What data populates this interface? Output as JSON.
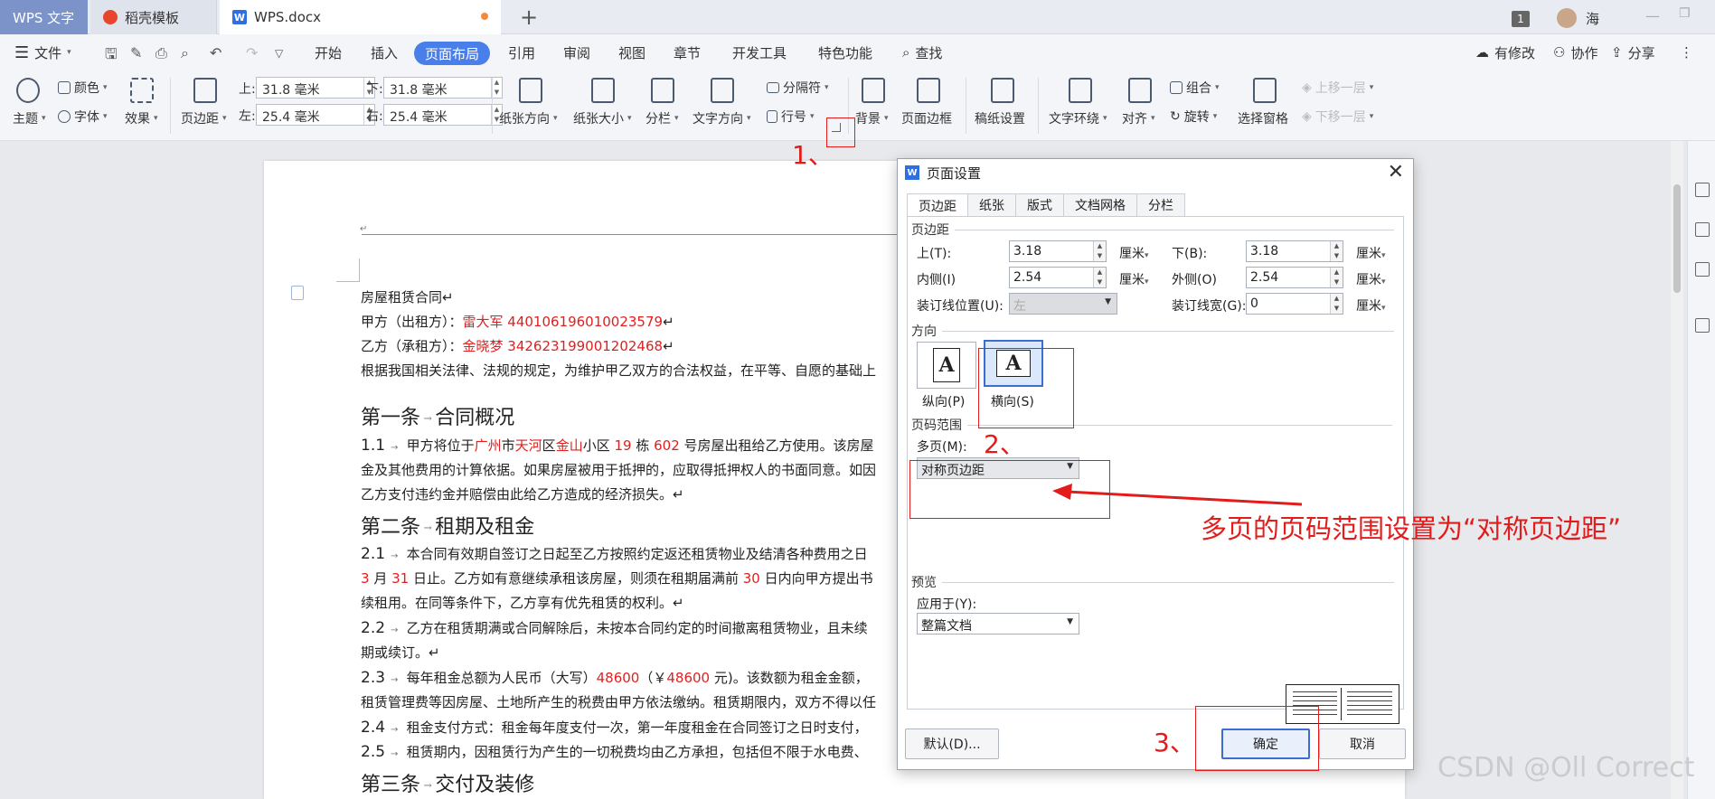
{
  "tabs": {
    "app": "WPS 文字",
    "template": "稻壳模板",
    "document": "WPS.docx",
    "new_tab_symbol": "+",
    "badge": "1",
    "user": "海"
  },
  "menu": {
    "file": "文件",
    "items": [
      "开始",
      "插入",
      "页面布局",
      "引用",
      "审阅",
      "视图",
      "章节",
      "开发工具",
      "特色功能"
    ],
    "active": "页面布局",
    "search": "查找",
    "right": [
      "有修改",
      "协作",
      "分享"
    ]
  },
  "ribbon": {
    "theme": "主题",
    "color": "颜色",
    "font": "字体",
    "effect": "效果",
    "margin": "页边距",
    "top_label": "上:",
    "top_value": "31.8 毫米",
    "bottom_label": "下:",
    "bottom_value": "31.8 毫米",
    "left_label": "左:",
    "left_value": "25.4 毫米",
    "right_label": "右:",
    "right_value": "25.4 毫米",
    "orientation": "纸张方向",
    "size": "纸张大小",
    "columns": "分栏",
    "text_direction": "文字方向",
    "separator": "分隔符",
    "line_number": "行号",
    "background": "背景",
    "page_border": "页面边框",
    "manuscript": "稿纸设置",
    "wrap": "文字环绕",
    "align": "对齐",
    "group": "组合",
    "rotate": "旋转",
    "selection_pane": "选择窗格",
    "bring_forward": "上移一层",
    "send_backward": "下移一层"
  },
  "document": {
    "lines": [
      {
        "parts": [
          [
            "房屋租赁合同↵",
            ""
          ]
        ]
      },
      {
        "parts": [
          [
            "甲方（出租方）：",
            ""
          ],
          [
            "雷大军 440106196010023579",
            "red"
          ],
          [
            "↵",
            ""
          ]
        ]
      },
      {
        "parts": [
          [
            "乙方（承租方）：",
            ""
          ],
          [
            "金晓梦 342623199001202468",
            "red"
          ],
          [
            "↵",
            ""
          ]
        ]
      },
      {
        "parts": [
          [
            "根据我国相关法律、法规的规定，为维护甲乙双方的合法权益，在平等、自愿的基础上",
            ""
          ]
        ]
      },
      {
        "heading": true,
        "parts": [
          [
            "第一条",
            ""
          ],
          [
            "合同概况",
            ""
          ]
        ]
      },
      {
        "num": "1.1",
        "parts": [
          [
            "甲方将位于",
            ""
          ],
          [
            "广州",
            "red"
          ],
          [
            "市",
            ""
          ],
          [
            "天河",
            "red"
          ],
          [
            "区",
            ""
          ],
          [
            "金山",
            "red"
          ],
          [
            "小区 ",
            ""
          ],
          [
            "19",
            "red"
          ],
          [
            " 栋 ",
            ""
          ],
          [
            "602",
            "red"
          ],
          [
            " 号房屋出租给乙方使用。该房屋",
            ""
          ]
        ]
      },
      {
        "parts": [
          [
            "金及其他费用的计算依据。如果房屋被用于抵押的，应取得抵押权人的书面同意。如因",
            ""
          ]
        ]
      },
      {
        "parts": [
          [
            "乙方支付违约金并赔偿由此给乙方造成的经济损失。↵",
            ""
          ]
        ]
      },
      {
        "heading": true,
        "parts": [
          [
            "第二条",
            ""
          ],
          [
            "租期及租金",
            ""
          ]
        ]
      },
      {
        "num": "2.1",
        "parts": [
          [
            "本合同有效期自签订之日起至乙方按照约定返还租赁物业及结清各种费用之日",
            ""
          ]
        ]
      },
      {
        "parts": [
          [
            "3",
            "red"
          ],
          [
            " 月 ",
            ""
          ],
          [
            "31",
            "red"
          ],
          [
            " 日止。乙方如有意继续承租该房屋，则须在租期届满前 ",
            ""
          ],
          [
            "30",
            "red"
          ],
          [
            " 日内向甲方提出书",
            ""
          ]
        ]
      },
      {
        "parts": [
          [
            "续租用。在同等条件下，乙方享有优先租赁的权利。↵",
            ""
          ]
        ]
      },
      {
        "num": "2.2",
        "parts": [
          [
            "乙方在租赁期满或合同解除后，未按本合同约定的时间撤离租赁物业，且未续",
            ""
          ]
        ]
      },
      {
        "parts": [
          [
            "期或续订。↵",
            ""
          ]
        ]
      },
      {
        "num": "2.3",
        "parts": [
          [
            "每年租金总额为人民币（大写）",
            ""
          ],
          [
            "48600",
            "red"
          ],
          [
            "（￥",
            ""
          ],
          [
            "48600",
            "red"
          ],
          [
            " 元)。该数额为租金金额，",
            ""
          ]
        ]
      },
      {
        "parts": [
          [
            "租赁管理费等因房屋、土地所产生的税费由甲方依法缴纳。租赁期限内，双方不得以任",
            ""
          ]
        ]
      },
      {
        "num": "2.4",
        "parts": [
          [
            "租金支付方式：租金每年度支付一次，第一年度租金在合同签订之日时支付，",
            ""
          ]
        ]
      },
      {
        "num": "2.5",
        "parts": [
          [
            "租赁期内，因租赁行为产生的一切税费均由乙方承担，包括但不限于水电费、",
            ""
          ]
        ]
      },
      {
        "heading": true,
        "parts": [
          [
            "第三条",
            ""
          ],
          [
            "交付及装修",
            ""
          ]
        ]
      }
    ]
  },
  "dialog": {
    "title": "页面设置",
    "tabs": [
      "页边距",
      "纸张",
      "版式",
      "文档网格",
      "分栏"
    ],
    "margin_group": "页边距",
    "top_label": "上(T):",
    "top_value": "3.18",
    "bottom_label": "下(B):",
    "bottom_value": "3.18",
    "inner_label": "内侧(I)",
    "inner_value": "2.54",
    "outer_label": "外侧(O)",
    "outer_value": "2.54",
    "gutter_pos_label": "装订线位置(U):",
    "gutter_pos_value": "左",
    "gutter_width_label": "装订线宽(G):",
    "gutter_width_value": "0",
    "unit": "厘米",
    "orientation_group": "方向",
    "portrait": "纵向(P)",
    "landscape": "横向(S)",
    "range_group": "页码范围",
    "multi_pages_label": "多页(M):",
    "multi_pages_value": "对称页边距",
    "preview_group": "预览",
    "apply_label": "应用于(Y):",
    "apply_value": "整篇文档",
    "default_button": "默认(D)...",
    "ok_button": "确定",
    "cancel_button": "取消"
  },
  "annotations": {
    "step1": "1、",
    "step2": "2、",
    "step3": "3、",
    "note": "多页的页码范围设置为“对称页边距”",
    "color": "#e21b1b"
  },
  "watermark": "CSDN @Oll Correct"
}
